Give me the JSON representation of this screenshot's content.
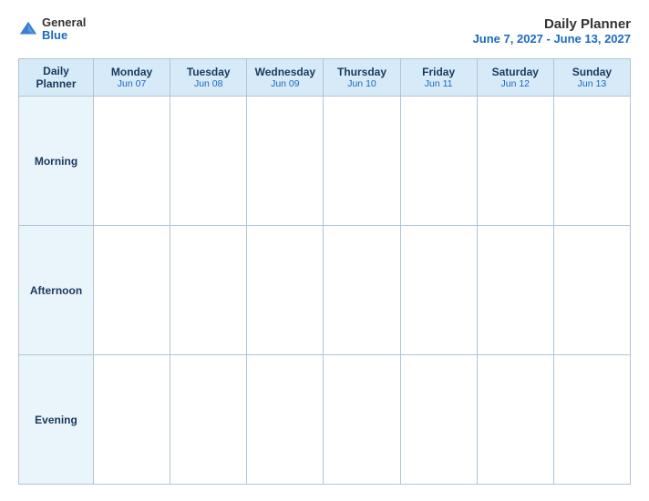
{
  "logo": {
    "general": "General",
    "blue": "Blue"
  },
  "header": {
    "title": "Daily Planner",
    "subtitle": "June 7, 2027 - June 13, 2027"
  },
  "table": {
    "first_col_header_line1": "Daily",
    "first_col_header_line2": "Planner",
    "columns": [
      {
        "day": "Monday",
        "date": "Jun 07"
      },
      {
        "day": "Tuesday",
        "date": "Jun 08"
      },
      {
        "day": "Wednesday",
        "date": "Jun 09"
      },
      {
        "day": "Thursday",
        "date": "Jun 10"
      },
      {
        "day": "Friday",
        "date": "Jun 11"
      },
      {
        "day": "Saturday",
        "date": "Jun 12"
      },
      {
        "day": "Sunday",
        "date": "Jun 13"
      }
    ],
    "rows": [
      {
        "label": "Morning"
      },
      {
        "label": "Afternoon"
      },
      {
        "label": "Evening"
      }
    ]
  }
}
